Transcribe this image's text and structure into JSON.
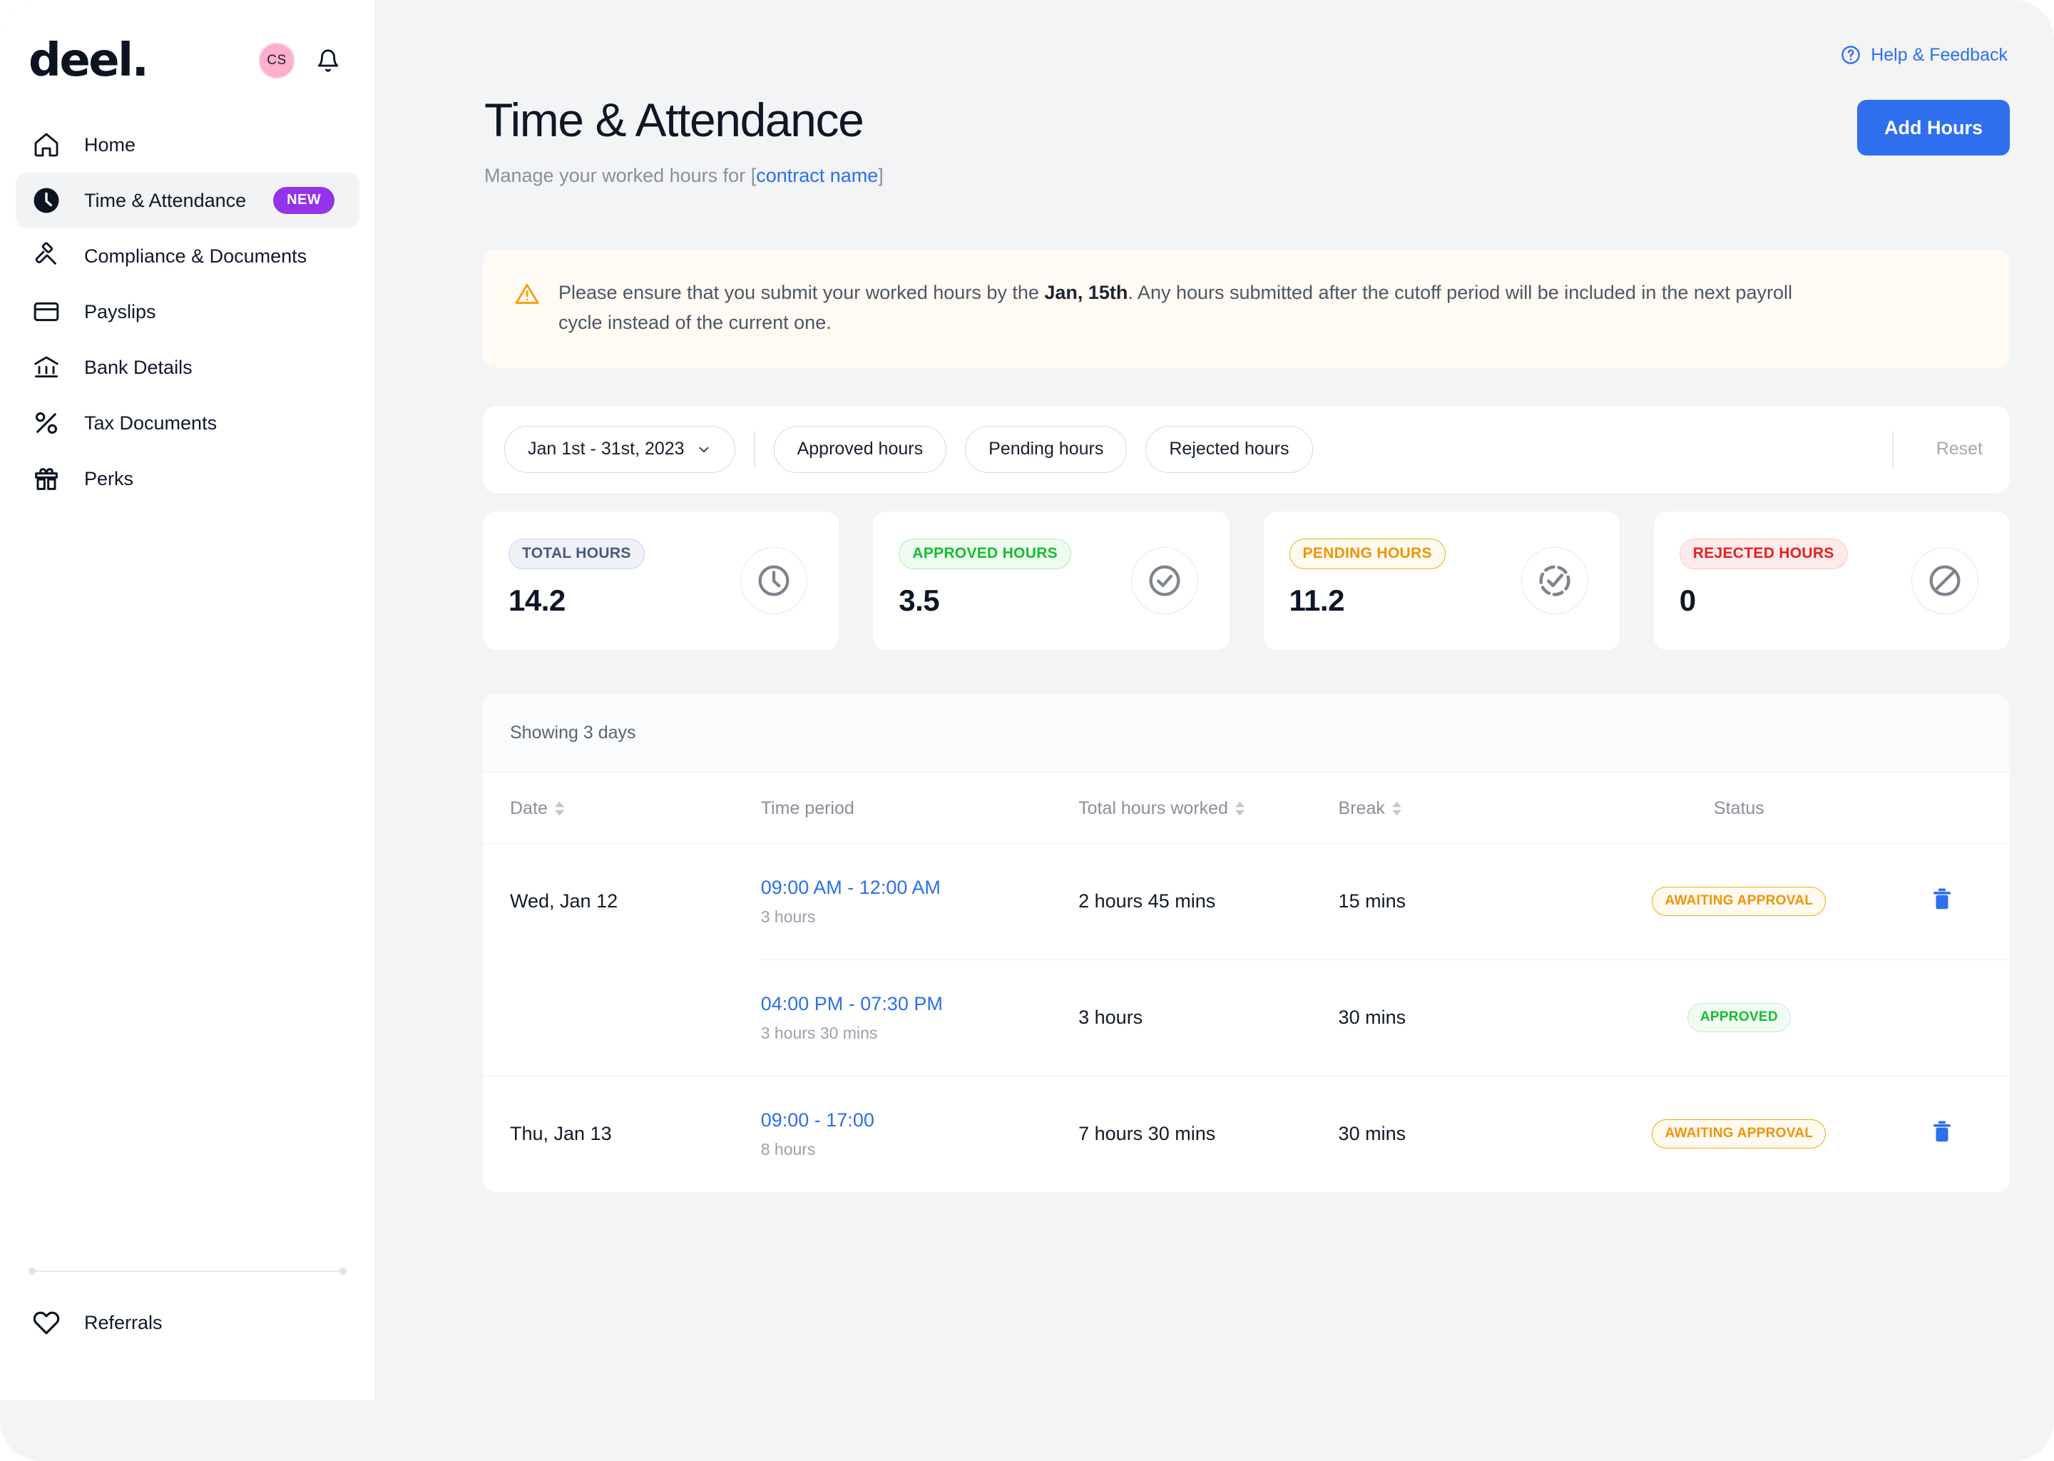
{
  "brand": {
    "logo": "deel.",
    "avatar_initials": "CS"
  },
  "sidebar": {
    "items": [
      {
        "label": "Home",
        "icon": "home-icon",
        "badge": null,
        "active": false
      },
      {
        "label": "Time & Attendance",
        "icon": "clock-icon",
        "badge": "NEW",
        "active": true
      },
      {
        "label": "Compliance & Documents",
        "icon": "gavel-icon",
        "badge": null,
        "active": false
      },
      {
        "label": "Payslips",
        "icon": "card-icon",
        "badge": null,
        "active": false
      },
      {
        "label": "Bank Details",
        "icon": "bank-icon",
        "badge": null,
        "active": false
      },
      {
        "label": "Tax Documents",
        "icon": "percent-icon",
        "badge": null,
        "active": false
      },
      {
        "label": "Perks",
        "icon": "gift-icon",
        "badge": null,
        "active": false
      }
    ],
    "bottom": {
      "label": "Referrals",
      "icon": "heart-icon"
    }
  },
  "header": {
    "help_label": "Help & Feedback",
    "title": "Time & Attendance",
    "subtitle_prefix": "Manage your worked hours for [",
    "subtitle_link": "contract name",
    "subtitle_suffix": "]",
    "add_hours_label": "Add Hours"
  },
  "banner": {
    "text_before": "Please ensure that you submit your worked hours by the ",
    "text_bold": "Jan, 15th",
    "text_after": ". Any hours submitted after the cutoff period will be included in the next payroll cycle instead of the current one."
  },
  "filters": {
    "date_range": "Jan 1st - 31st, 2023",
    "chips": [
      "Approved hours",
      "Pending hours",
      "Rejected hours"
    ],
    "reset_label": "Reset"
  },
  "stats": [
    {
      "label": "TOTAL HOURS",
      "value": "14.2",
      "icon": "clock-icon",
      "tone": "total"
    },
    {
      "label": "APPROVED HOURS",
      "value": "3.5",
      "icon": "check-circle-icon",
      "tone": "approved"
    },
    {
      "label": "PENDING HOURS",
      "value": "11.2",
      "icon": "pending-check-icon",
      "tone": "pending"
    },
    {
      "label": "REJECTED HOURS",
      "value": "0",
      "icon": "blocked-icon",
      "tone": "rejected"
    }
  ],
  "table": {
    "showing": "Showing 3 days",
    "columns": [
      "Date",
      "Time period",
      "Total hours worked",
      "Break",
      "Status"
    ],
    "rows": [
      {
        "date": "Wed, Jan 12",
        "time_period": "09:00 AM - 12:00 AM",
        "time_duration": "3 hours",
        "total_hours": "2 hours 45 mins",
        "break": "15 mins",
        "status": "AWAITING APPROVAL",
        "status_tone": "await",
        "deletable": true,
        "is_continuation": false
      },
      {
        "date": "",
        "time_period": "04:00 PM - 07:30 PM",
        "time_duration": "3 hours 30 mins",
        "total_hours": "3 hours",
        "break": "30 mins",
        "status": "APPROVED",
        "status_tone": "appr",
        "deletable": false,
        "is_continuation": true
      },
      {
        "date": "Thu, Jan 13",
        "time_period": "09:00 - 17:00",
        "time_duration": "8 hours",
        "total_hours": "7 hours 30 mins",
        "break": "30 mins",
        "status": "AWAITING APPROVAL",
        "status_tone": "await",
        "deletable": true,
        "is_continuation": false
      }
    ]
  },
  "colors": {
    "accent_blue": "#2f6fed",
    "badge_purple": "#9333ea",
    "avatar_pink": "#ffafcc",
    "warn_orange": "#f0930c",
    "success_green": "#17bd2f",
    "danger_red": "#e42121",
    "page_bg": "#f3f4f6"
  }
}
